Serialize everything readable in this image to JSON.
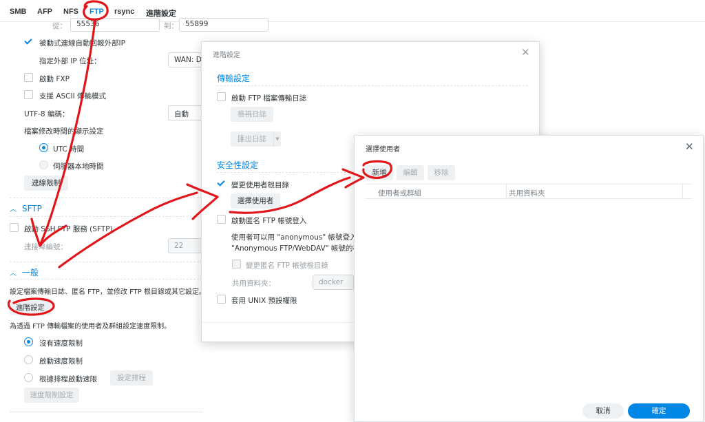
{
  "tabs": [
    "SMB",
    "AFP",
    "NFS",
    "FTP",
    "rsync",
    "進階設定"
  ],
  "ftp": {
    "port_from_label": "從：",
    "port_from": "55536",
    "port_to_label": "到：",
    "port_to": "55899",
    "passive_auto_report": "被動式連線自動回報外部IP",
    "external_ip_label": "指定外部 IP 位址：",
    "external_ip_value": "WAN: D",
    "enable_fxp": "啟動 FXP",
    "ascii_mode": "支援 ASCII 傳輸模式",
    "utf8_label": "UTF-8 編碼：",
    "utf8_value": "自動",
    "mtime_label": "檔案修改時間的顯示設定",
    "mtime_utc": "UTC 時間",
    "mtime_local": "伺服器本地時間",
    "connection_limit_btn": "連線限制"
  },
  "sftp": {
    "title": "SFTP",
    "enable": "啟動 SSH FTP 服務 (SFTP)",
    "port_label": "連接埠編號：",
    "port_value": "22"
  },
  "general": {
    "title": "一般",
    "desc": "設定檔案傳輸日誌、匿名 FTP，並修改 FTP 根目錄或其它設定。",
    "advanced_btn": "進階設定",
    "speed_desc": "為透過 FTP 傳輸檔案的使用者及群組設定速度限制。",
    "no_limit": "沒有速度限制",
    "enable_limit": "啟動速度限制",
    "schedule_limit": "根據排程啟動速限",
    "schedule_btn": "設定排程",
    "speed_settings_btn": "速度限制設定"
  },
  "advanced_dialog": {
    "title": "進階設定",
    "transfer_section": "傳輸設定",
    "enable_log": "啟動 FTP 檔案傳輸日誌",
    "view_log": "檢視日誌",
    "export_log": "匯出日誌",
    "security_section": "安全性設定",
    "change_root": "變更使用者根目錄",
    "select_user_btn": "選擇使用者",
    "anonymous_login": "啟動匿名 FTP 帳號登入",
    "anon_desc_1": "使用者可以用 \"anonymous\" 帳號登入FT",
    "anon_desc_2": "\"Anonymous FTP/WebDAV\" 帳號的存",
    "change_anon_root": "變更匿名 FTP 帳號根目錄",
    "shared_folder_label": "共用資料夾：",
    "shared_folder_value": "docker",
    "unix_perm": "套用 UNIX 預設權限"
  },
  "select_user_dialog": {
    "title": "選擇使用者",
    "add": "新增",
    "edit": "編輯",
    "remove": "移除",
    "col_user": "使用者或群組",
    "col_folder": "共用資料夾",
    "cancel": "取消",
    "ok": "確定"
  },
  "colors": {
    "accent": "#0086e5",
    "annotation": "#e0161b"
  }
}
